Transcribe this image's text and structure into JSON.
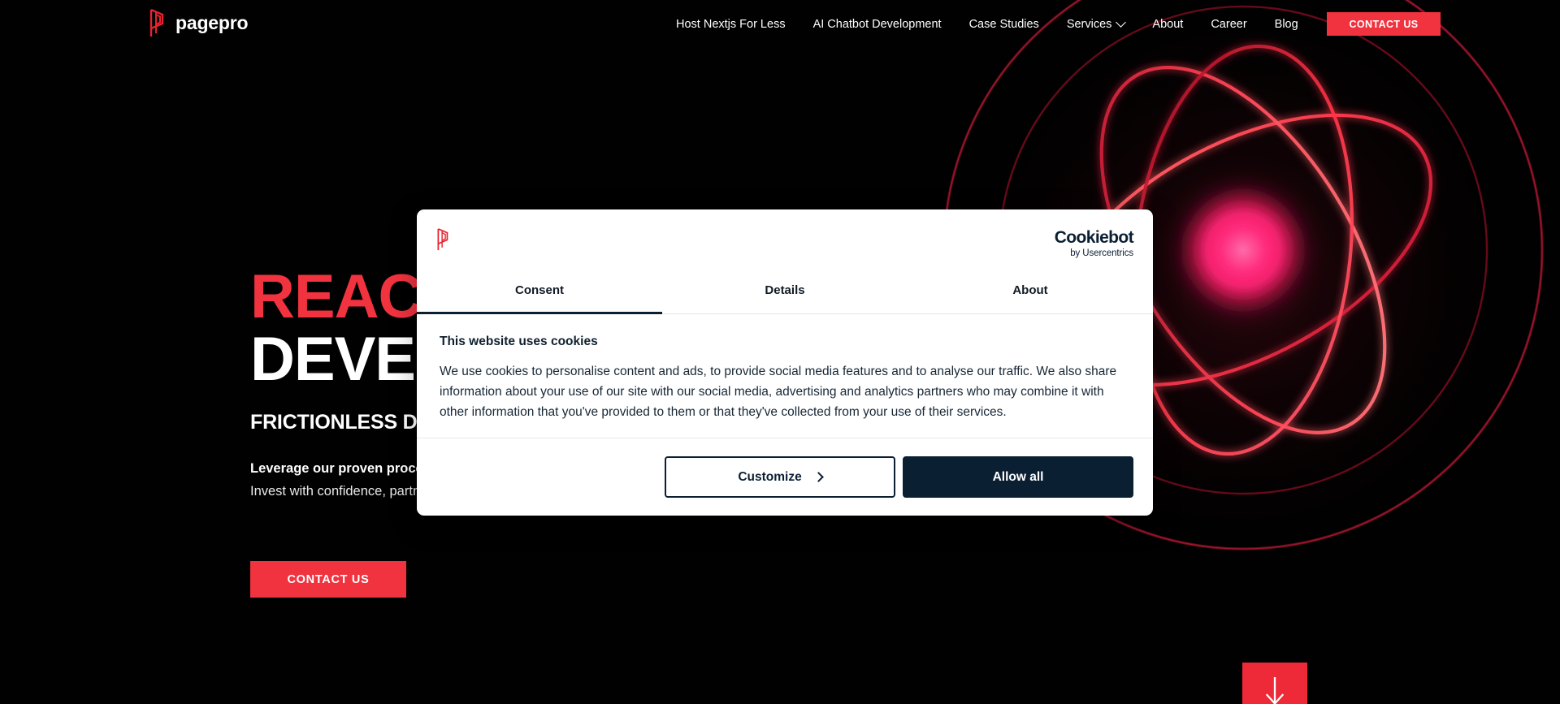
{
  "brand": {
    "name": "pagepro",
    "logo_icon": "pagepro-p-logo"
  },
  "nav": {
    "links": [
      {
        "label": "Host Nextjs For Less",
        "has_chevron": false
      },
      {
        "label": "AI Chatbot Development",
        "has_chevron": false
      },
      {
        "label": "Case Studies",
        "has_chevron": false
      },
      {
        "label": "Services",
        "has_chevron": true
      },
      {
        "label": "About",
        "has_chevron": false
      },
      {
        "label": "Career",
        "has_chevron": false
      },
      {
        "label": "Blog",
        "has_chevron": false
      }
    ],
    "cta_label": "CONTACT US"
  },
  "hero": {
    "headline_line1": "REACT",
    "headline_line2": "DEVELOPMENT",
    "subheadline": "FRICTIONLESS DELIVERY",
    "paragraph_strong": "Leverage our proven process and expertise.",
    "paragraph_rest": "Invest with confidence, partner with us.",
    "cta_label": "CONTACT US",
    "scroll_icon": "arrow-down-icon"
  },
  "cookie_dialog": {
    "logo_icon": "pagepro-p-logo",
    "provider_name": "Cookiebot",
    "provider_subtitle": "by Usercentrics",
    "tabs": [
      {
        "label": "Consent",
        "active": true
      },
      {
        "label": "Details",
        "active": false
      },
      {
        "label": "About",
        "active": false
      }
    ],
    "title": "This website uses cookies",
    "body": "We use cookies to personalise content and ads, to provide social media features and to analyse our traffic. We also share information about your use of our site with our social media, advertising and analytics partners who may combine it with other information that you've provided to them or that they've collected from your use of their services.",
    "customize_label": "Customize",
    "allow_all_label": "Allow all"
  },
  "colors": {
    "brand_red": "#F0333F",
    "cta_red": "#EE2A38",
    "dialog_dark": "#0B1F33",
    "hero_background": "#010101",
    "nucleus_pink": "#FF2E7E"
  }
}
